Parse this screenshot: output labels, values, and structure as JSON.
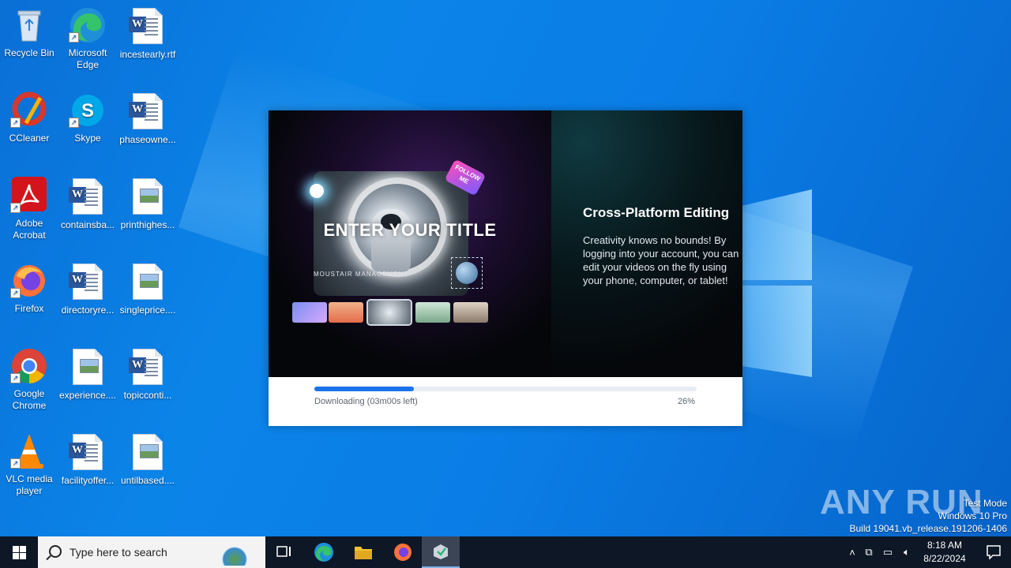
{
  "desktop": {
    "icons": [
      {
        "label": "Recycle Bin",
        "icon": "recycle-bin-icon"
      },
      {
        "label": "Microsoft Edge",
        "icon": "edge-icon"
      },
      {
        "label": "incestearly.rtf",
        "icon": "word-doc-icon"
      },
      {
        "label": "CCleaner",
        "icon": "ccleaner-icon"
      },
      {
        "label": "Skype",
        "icon": "skype-icon"
      },
      {
        "label": "phaseowne...",
        "icon": "word-doc-icon"
      },
      {
        "label": "Adobe Acrobat",
        "icon": "acrobat-icon"
      },
      {
        "label": "containsba...",
        "icon": "word-doc-icon"
      },
      {
        "label": "printhighes...",
        "icon": "image-file-icon"
      },
      {
        "label": "Firefox",
        "icon": "firefox-icon"
      },
      {
        "label": "directoryre...",
        "icon": "word-doc-icon"
      },
      {
        "label": "singleprice....",
        "icon": "image-file-icon"
      },
      {
        "label": "Google Chrome",
        "icon": "chrome-icon"
      },
      {
        "label": "experience....",
        "icon": "image-file-icon"
      },
      {
        "label": "topicconti...",
        "icon": "word-doc-icon"
      },
      {
        "label": "VLC media player",
        "icon": "vlc-icon"
      },
      {
        "label": "facilityoffer...",
        "icon": "word-doc-icon"
      },
      {
        "label": "untilbased....",
        "icon": "image-file-icon"
      }
    ]
  },
  "installer": {
    "hero": {
      "template_title": "ENTER YOUR TITLE",
      "template_subtitle": "MOUSTAIR MANAGEMENT",
      "sticker": "FOLLOW ME",
      "heading": "Cross-Platform Editing",
      "body": "Creativity knows no bounds! By logging into your account, you can edit your videos on the fly using your phone, computer, or tablet!"
    },
    "progress": {
      "status": "Downloading (03m00s left)",
      "percent_label": "26%",
      "fraction": 0.26,
      "color": "#1a73e8"
    }
  },
  "watermark": {
    "brand": "ANY RUN",
    "line1": "Test Mode",
    "line2": "Windows 10 Pro",
    "line3": "Build 19041.vb_release.191206-1406"
  },
  "taskbar": {
    "search_placeholder": "Type here to search",
    "apps": [
      "task-view-icon",
      "edge-icon",
      "file-explorer-icon",
      "firefox-icon",
      "installer-icon"
    ],
    "time": "8:18 AM",
    "date": "8/22/2024"
  }
}
